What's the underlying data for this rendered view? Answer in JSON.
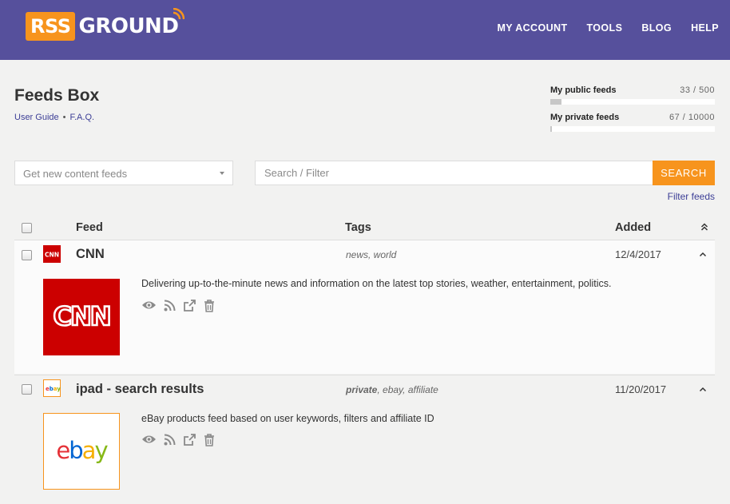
{
  "header": {
    "logo_left": "RSS",
    "logo_right": "GROUND",
    "nav": [
      "MY ACCOUNT",
      "TOOLS",
      "BLOG",
      "HELP"
    ],
    "bg_color": "#56509c",
    "accent_color": "#f7941d"
  },
  "page": {
    "title": "Feeds Box",
    "links": [
      "User Guide",
      "F.A.Q."
    ],
    "separator": "•"
  },
  "quotas": [
    {
      "label": "My public feeds",
      "count": "33 / 500",
      "fraction": 0.066
    },
    {
      "label": "My private feeds",
      "count": "67 / 10000",
      "fraction": 0.0067
    }
  ],
  "controls": {
    "dropdown_value": "Get new content feeds",
    "search_placeholder": "Search / Filter",
    "search_button": "SEARCH",
    "filter_link": "Filter feeds"
  },
  "table": {
    "columns": [
      "Feed",
      "Tags",
      "Added"
    ]
  },
  "feeds": [
    {
      "title": "CNN",
      "tags_private": "",
      "tags": "news, world",
      "added": "12/4/2017",
      "description": "Delivering up-to-the-minute news and information on the latest top stories, weather, entertainment, politics.",
      "logo": "cnn-logo"
    },
    {
      "title": "ipad - search results",
      "tags_private": "private",
      "tags": ", ebay, affiliate",
      "added": "11/20/2017",
      "description": "eBay products feed based on user keywords, filters and affiliate ID",
      "logo": "ebay-logo"
    }
  ],
  "action_icons": [
    "eye-icon",
    "rss-icon",
    "external-link-icon",
    "trash-icon"
  ]
}
